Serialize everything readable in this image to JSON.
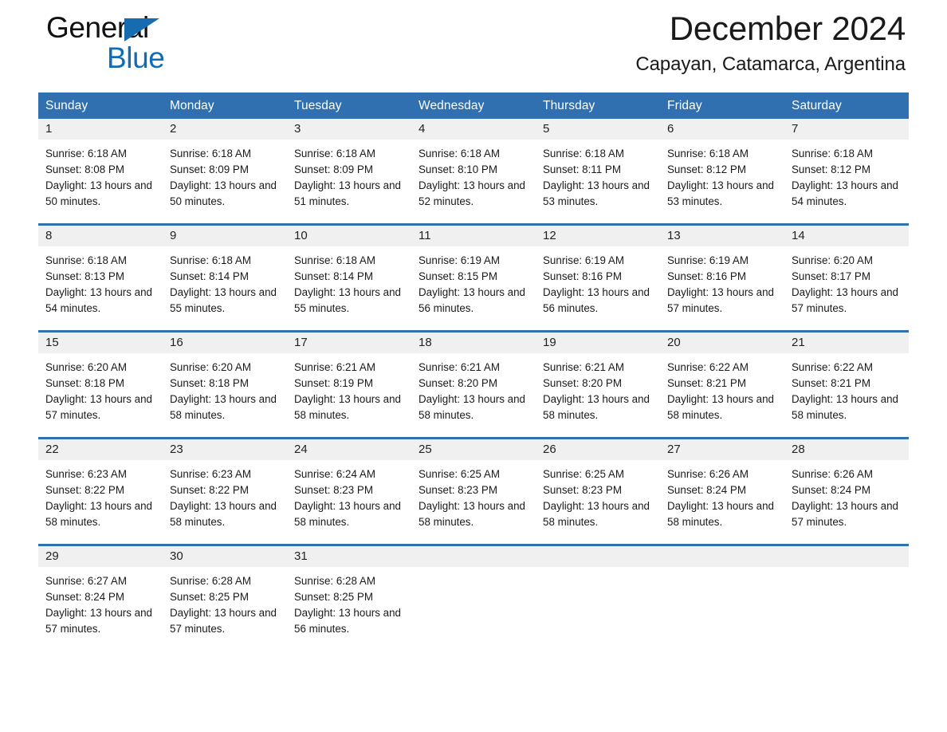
{
  "logo": {
    "word1": "General",
    "word2": "Blue",
    "triangle_color": "#176BB0",
    "blue_color": "#0F6CB6"
  },
  "header": {
    "month_title": "December 2024",
    "location": "Capayan, Catamarca, Argentina"
  },
  "colors": {
    "header_blue": "#3070B0",
    "date_band_gray": "#F0F0F0",
    "text": "#1a1a1a"
  },
  "weekdays": [
    "Sunday",
    "Monday",
    "Tuesday",
    "Wednesday",
    "Thursday",
    "Friday",
    "Saturday"
  ],
  "weeks": [
    {
      "days": [
        {
          "date": "1",
          "sunrise": "Sunrise: 6:18 AM",
          "sunset": "Sunset: 8:08 PM",
          "daylight": "Daylight: 13 hours and 50 minutes."
        },
        {
          "date": "2",
          "sunrise": "Sunrise: 6:18 AM",
          "sunset": "Sunset: 8:09 PM",
          "daylight": "Daylight: 13 hours and 50 minutes."
        },
        {
          "date": "3",
          "sunrise": "Sunrise: 6:18 AM",
          "sunset": "Sunset: 8:09 PM",
          "daylight": "Daylight: 13 hours and 51 minutes."
        },
        {
          "date": "4",
          "sunrise": "Sunrise: 6:18 AM",
          "sunset": "Sunset: 8:10 PM",
          "daylight": "Daylight: 13 hours and 52 minutes."
        },
        {
          "date": "5",
          "sunrise": "Sunrise: 6:18 AM",
          "sunset": "Sunset: 8:11 PM",
          "daylight": "Daylight: 13 hours and 53 minutes."
        },
        {
          "date": "6",
          "sunrise": "Sunrise: 6:18 AM",
          "sunset": "Sunset: 8:12 PM",
          "daylight": "Daylight: 13 hours and 53 minutes."
        },
        {
          "date": "7",
          "sunrise": "Sunrise: 6:18 AM",
          "sunset": "Sunset: 8:12 PM",
          "daylight": "Daylight: 13 hours and 54 minutes."
        }
      ]
    },
    {
      "days": [
        {
          "date": "8",
          "sunrise": "Sunrise: 6:18 AM",
          "sunset": "Sunset: 8:13 PM",
          "daylight": "Daylight: 13 hours and 54 minutes."
        },
        {
          "date": "9",
          "sunrise": "Sunrise: 6:18 AM",
          "sunset": "Sunset: 8:14 PM",
          "daylight": "Daylight: 13 hours and 55 minutes."
        },
        {
          "date": "10",
          "sunrise": "Sunrise: 6:18 AM",
          "sunset": "Sunset: 8:14 PM",
          "daylight": "Daylight: 13 hours and 55 minutes."
        },
        {
          "date": "11",
          "sunrise": "Sunrise: 6:19 AM",
          "sunset": "Sunset: 8:15 PM",
          "daylight": "Daylight: 13 hours and 56 minutes."
        },
        {
          "date": "12",
          "sunrise": "Sunrise: 6:19 AM",
          "sunset": "Sunset: 8:16 PM",
          "daylight": "Daylight: 13 hours and 56 minutes."
        },
        {
          "date": "13",
          "sunrise": "Sunrise: 6:19 AM",
          "sunset": "Sunset: 8:16 PM",
          "daylight": "Daylight: 13 hours and 57 minutes."
        },
        {
          "date": "14",
          "sunrise": "Sunrise: 6:20 AM",
          "sunset": "Sunset: 8:17 PM",
          "daylight": "Daylight: 13 hours and 57 minutes."
        }
      ]
    },
    {
      "days": [
        {
          "date": "15",
          "sunrise": "Sunrise: 6:20 AM",
          "sunset": "Sunset: 8:18 PM",
          "daylight": "Daylight: 13 hours and 57 minutes."
        },
        {
          "date": "16",
          "sunrise": "Sunrise: 6:20 AM",
          "sunset": "Sunset: 8:18 PM",
          "daylight": "Daylight: 13 hours and 58 minutes."
        },
        {
          "date": "17",
          "sunrise": "Sunrise: 6:21 AM",
          "sunset": "Sunset: 8:19 PM",
          "daylight": "Daylight: 13 hours and 58 minutes."
        },
        {
          "date": "18",
          "sunrise": "Sunrise: 6:21 AM",
          "sunset": "Sunset: 8:20 PM",
          "daylight": "Daylight: 13 hours and 58 minutes."
        },
        {
          "date": "19",
          "sunrise": "Sunrise: 6:21 AM",
          "sunset": "Sunset: 8:20 PM",
          "daylight": "Daylight: 13 hours and 58 minutes."
        },
        {
          "date": "20",
          "sunrise": "Sunrise: 6:22 AM",
          "sunset": "Sunset: 8:21 PM",
          "daylight": "Daylight: 13 hours and 58 minutes."
        },
        {
          "date": "21",
          "sunrise": "Sunrise: 6:22 AM",
          "sunset": "Sunset: 8:21 PM",
          "daylight": "Daylight: 13 hours and 58 minutes."
        }
      ]
    },
    {
      "days": [
        {
          "date": "22",
          "sunrise": "Sunrise: 6:23 AM",
          "sunset": "Sunset: 8:22 PM",
          "daylight": "Daylight: 13 hours and 58 minutes."
        },
        {
          "date": "23",
          "sunrise": "Sunrise: 6:23 AM",
          "sunset": "Sunset: 8:22 PM",
          "daylight": "Daylight: 13 hours and 58 minutes."
        },
        {
          "date": "24",
          "sunrise": "Sunrise: 6:24 AM",
          "sunset": "Sunset: 8:23 PM",
          "daylight": "Daylight: 13 hours and 58 minutes."
        },
        {
          "date": "25",
          "sunrise": "Sunrise: 6:25 AM",
          "sunset": "Sunset: 8:23 PM",
          "daylight": "Daylight: 13 hours and 58 minutes."
        },
        {
          "date": "26",
          "sunrise": "Sunrise: 6:25 AM",
          "sunset": "Sunset: 8:23 PM",
          "daylight": "Daylight: 13 hours and 58 minutes."
        },
        {
          "date": "27",
          "sunrise": "Sunrise: 6:26 AM",
          "sunset": "Sunset: 8:24 PM",
          "daylight": "Daylight: 13 hours and 58 minutes."
        },
        {
          "date": "28",
          "sunrise": "Sunrise: 6:26 AM",
          "sunset": "Sunset: 8:24 PM",
          "daylight": "Daylight: 13 hours and 57 minutes."
        }
      ]
    },
    {
      "days": [
        {
          "date": "29",
          "sunrise": "Sunrise: 6:27 AM",
          "sunset": "Sunset: 8:24 PM",
          "daylight": "Daylight: 13 hours and 57 minutes."
        },
        {
          "date": "30",
          "sunrise": "Sunrise: 6:28 AM",
          "sunset": "Sunset: 8:25 PM",
          "daylight": "Daylight: 13 hours and 57 minutes."
        },
        {
          "date": "31",
          "sunrise": "Sunrise: 6:28 AM",
          "sunset": "Sunset: 8:25 PM",
          "daylight": "Daylight: 13 hours and 56 minutes."
        },
        {
          "date": "",
          "sunrise": "",
          "sunset": "",
          "daylight": ""
        },
        {
          "date": "",
          "sunrise": "",
          "sunset": "",
          "daylight": ""
        },
        {
          "date": "",
          "sunrise": "",
          "sunset": "",
          "daylight": ""
        },
        {
          "date": "",
          "sunrise": "",
          "sunset": "",
          "daylight": ""
        }
      ]
    }
  ]
}
